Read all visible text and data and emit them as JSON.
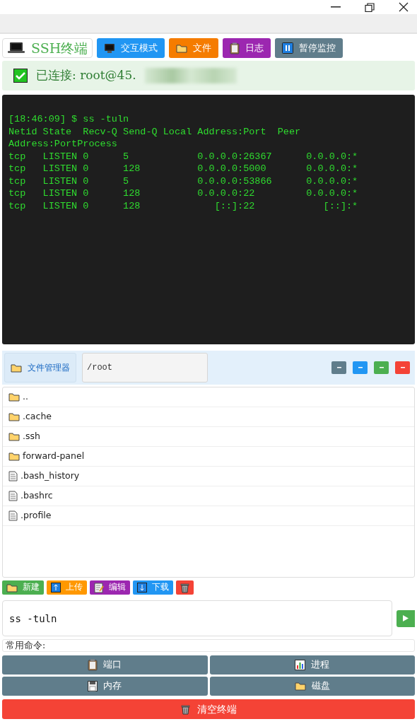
{
  "header": {
    "title": "SSH终端",
    "buttons": [
      {
        "label": "交互模式",
        "color": "#2196f3"
      },
      {
        "label": "文件",
        "color": "#f57c00"
      },
      {
        "label": "日志",
        "color": "#9c27b0"
      },
      {
        "label": "暂停监控",
        "color": "#607d8b"
      }
    ]
  },
  "status": {
    "connected": true,
    "text": "已连接: root@45."
  },
  "terminal": {
    "lines": [
      "[18:46:09] $ ss -tuln",
      "Netid State  Recv-Q Send-Q Local Address:Port  Peer",
      "Address:PortProcess",
      "tcp   LISTEN 0      5            0.0.0.0:26367      0.0.0.0:*",
      "tcp   LISTEN 0      128          0.0.0.0:5000       0.0.0.0:*",
      "tcp   LISTEN 0      5            0.0.0.0:53866      0.0.0.0:*",
      "tcp   LISTEN 0      128          0.0.0.0:22         0.0.0.0:*",
      "tcp   LISTEN 0      128             [::]:22            [::]:*"
    ]
  },
  "file_manager": {
    "title": "文件管理器",
    "path": "/root",
    "tools": [
      {
        "color": "#607d8b"
      },
      {
        "color": "#2196f3"
      },
      {
        "color": "#4caf50"
      },
      {
        "color": "#f44336"
      }
    ],
    "items": [
      {
        "name": "..",
        "kind": "folder"
      },
      {
        "name": ".cache",
        "kind": "folder"
      },
      {
        "name": ".ssh",
        "kind": "folder"
      },
      {
        "name": "forward-panel",
        "kind": "folder"
      },
      {
        "name": ".bash_history",
        "kind": "file"
      },
      {
        "name": ".bashrc",
        "kind": "file"
      },
      {
        "name": ".profile",
        "kind": "file"
      }
    ],
    "actions": [
      {
        "label": "新建",
        "color": "#4caf50"
      },
      {
        "label": "上传",
        "color": "#ff9800"
      },
      {
        "label": "编辑",
        "color": "#9c27b0"
      },
      {
        "label": "下载",
        "color": "#2196f3"
      },
      {
        "color": "#f44336"
      }
    ]
  },
  "command": {
    "value": "ss -tuln"
  },
  "quick": {
    "label": "常用命令:",
    "buttons": [
      {
        "label": "端口"
      },
      {
        "label": "进程"
      },
      {
        "label": "内存"
      },
      {
        "label": "磁盘"
      }
    ]
  },
  "clear_button": {
    "label": "清空终端"
  }
}
